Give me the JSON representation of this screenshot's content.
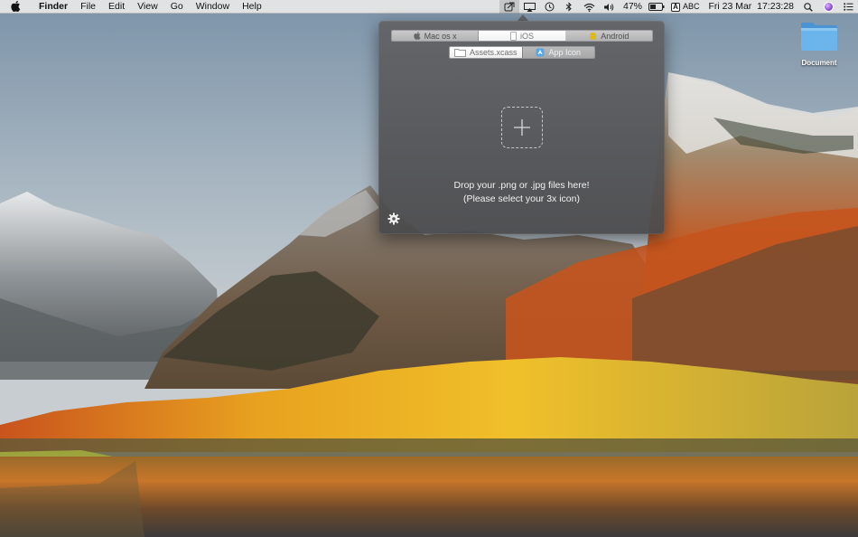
{
  "menubar": {
    "app_name": "Finder",
    "menus": [
      "File",
      "Edit",
      "View",
      "Go",
      "Window",
      "Help"
    ],
    "status": {
      "battery": "47%",
      "input_source": "ABC",
      "input_badge": "A",
      "datetime": "Fri 23 Mar  17:23:28"
    },
    "icons": [
      "apple-icon",
      "app-status-icon",
      "airplay-icon",
      "time-machine-icon",
      "bluetooth-icon",
      "wifi-icon",
      "volume-icon",
      "battery-icon",
      "spotlight-icon",
      "siri-icon",
      "notification-center-icon"
    ]
  },
  "desktop": {
    "icons": [
      {
        "label": "Document",
        "type": "folder"
      }
    ]
  },
  "popover": {
    "platform_tabs": [
      {
        "label": "Mac os x",
        "icon": "apple-icon",
        "selected": false
      },
      {
        "label": "iOS",
        "icon": "iphone-icon",
        "selected": true
      },
      {
        "label": "Android",
        "icon": "android-icon",
        "selected": false
      }
    ],
    "asset_tabs": [
      {
        "label": "Assets.xcass",
        "icon": "folder-icon",
        "selected": true
      },
      {
        "label": "App Icon",
        "icon": "app-icon",
        "selected": false
      }
    ],
    "drop_text_line1": "Drop your .png or .jpg files here!",
    "drop_text_line2": "(Please select your 3x icon)"
  },
  "colors": {
    "accent_android": "#a4c639",
    "folder_blue": "#5aa6e3",
    "panel_bg": "#5e5e60"
  }
}
